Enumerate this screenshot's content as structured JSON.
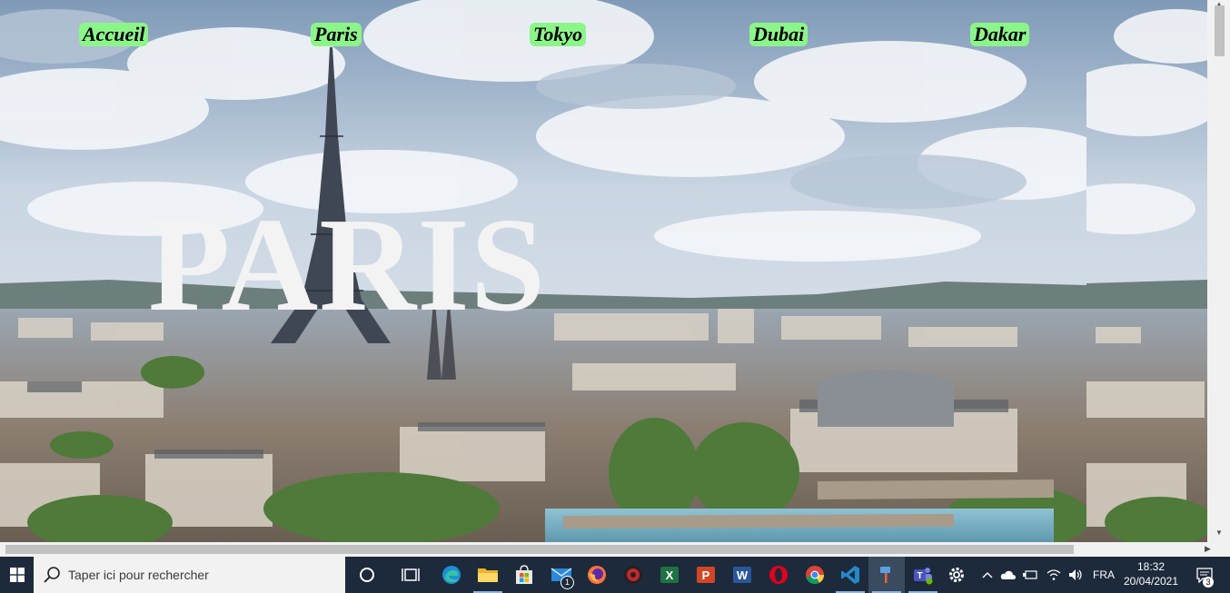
{
  "nav": {
    "accueil": "Accueil",
    "paris": "Paris",
    "tokyo": "Tokyo",
    "dubai": "Dubai",
    "dakar": "Dakar"
  },
  "hero": {
    "title": "PARIS",
    "nav_highlight_color": "#8cf58a",
    "title_color": "#f3f3f3"
  },
  "taskbar": {
    "search_placeholder": "Taper ici pour rechercher",
    "apps": [
      "task-view",
      "edge",
      "file-explorer",
      "microsoft-store",
      "mail",
      "firefox",
      "davinci-resolve",
      "excel",
      "powerpoint",
      "word",
      "opera",
      "chrome",
      "vscode",
      "paint-brush-app",
      "teams",
      "settings"
    ],
    "mail_badge": "1",
    "language": "FRA",
    "time": "18:32",
    "date": "20/04/2021",
    "notifications_count": "3"
  }
}
